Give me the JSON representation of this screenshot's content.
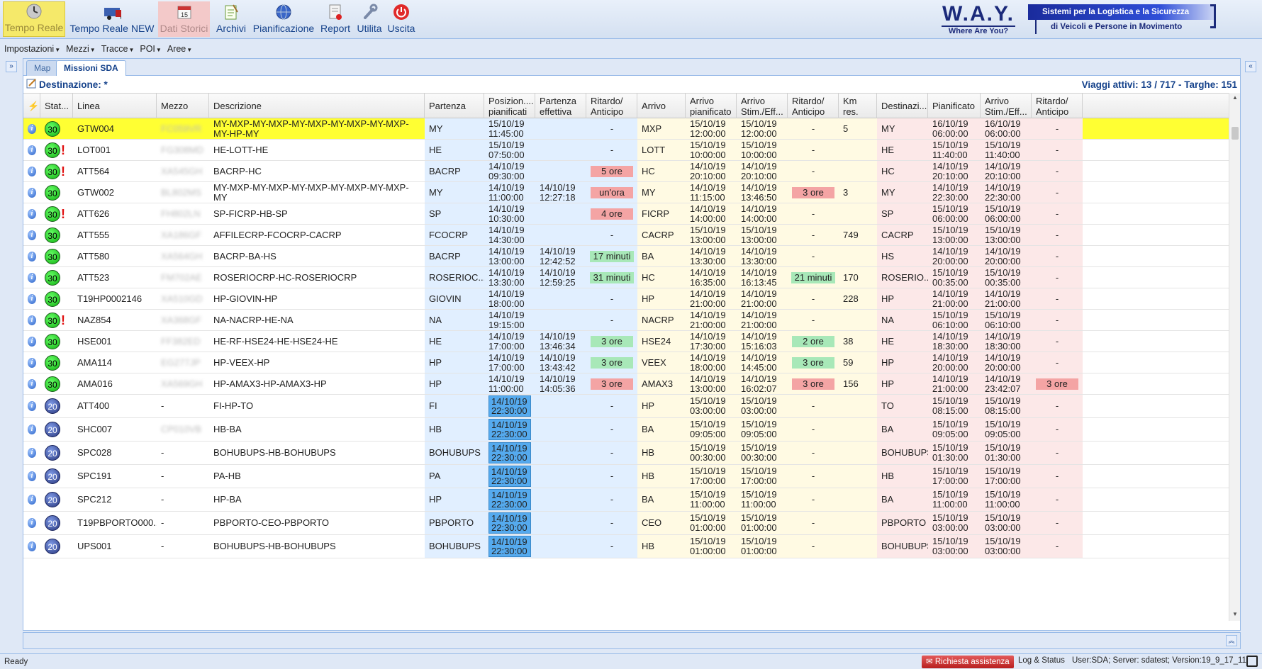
{
  "toolbar": {
    "buttons": [
      {
        "label": "Tempo Reale",
        "icon": "clock-icon",
        "state": "active"
      },
      {
        "label": "Tempo Reale NEW",
        "icon": "trucks-icon",
        "state": "normal"
      },
      {
        "label": "Dati Storici",
        "icon": "calendar-icon",
        "state": "disabled",
        "calendar_day": "15"
      },
      {
        "label": "Archivi",
        "icon": "notepad-icon",
        "state": "normal"
      },
      {
        "label": "Pianificazione",
        "icon": "globe-icon",
        "state": "normal"
      },
      {
        "label": "Report",
        "icon": "report-icon",
        "state": "normal"
      },
      {
        "label": "Utilita",
        "icon": "wrench-icon",
        "state": "normal"
      },
      {
        "label": "Uscita",
        "icon": "power-icon",
        "state": "normal"
      }
    ],
    "logo_title": "W.A.Y.",
    "logo_subtitle": "Where Are You?",
    "brand_line1": "Sistemi per la Logistica e la Sicurezza",
    "brand_line2": "di Veicoli e Persone in Movimento"
  },
  "menu": [
    "Impostazioni",
    "Mezzi",
    "Tracce",
    "POI",
    "Aree"
  ],
  "tabs": [
    {
      "label": "Map"
    },
    {
      "label": "Missioni SDA"
    }
  ],
  "panel": {
    "title": "Destinazione: *",
    "summary": "Viaggi attivi: 13 / 717 - Targhe: 151"
  },
  "columns": [
    "",
    "Stat...",
    "Linea",
    "Mezzo",
    "Descrizione",
    "Partenza",
    "Posizion.... pianificati",
    "Partenza effettiva",
    "Ritardo/ Anticipo",
    "Arrivo",
    "Arrivo pianificato",
    "Arrivo Stim./Eff...",
    "Ritardo/ Anticipo",
    "Km res.",
    "Destinazi...",
    "Pianificato",
    "Arrivo Stim./Eff...",
    "Ritardo/ Anticipo"
  ],
  "rows": [
    {
      "status": "30",
      "alert": false,
      "linea": "GTW004",
      "mezzo": "FC059VR",
      "mezzo_blur": true,
      "desc": "MY-MXP-MY-MXP-MY-MXP-MY-MXP-MY-MXP-MY-HP-MY",
      "dep": "MY",
      "dep_plan": "15/10/19 11:45:00",
      "dep_eff": "",
      "dep_delay": "-",
      "dep_delay_kind": "",
      "arr": "MXP",
      "arr_plan": "15/10/19 12:00:00",
      "arr_est": "15/10/19 12:00:00",
      "arr_delay": "-",
      "arr_delay_kind": "",
      "km": "5",
      "dst": "MY",
      "dst_plan": "16/10/19 06:00:00",
      "dst_est": "16/10/19 06:00:00",
      "dst_delay": "-",
      "dst_delay_kind": ""
    },
    {
      "status": "30",
      "alert": true,
      "linea": "LOT001",
      "mezzo": "FG308MD",
      "mezzo_blur": true,
      "desc": "HE-LOTT-HE",
      "dep": "HE",
      "dep_plan": "15/10/19 07:50:00",
      "dep_eff": "",
      "dep_delay": "-",
      "dep_delay_kind": "",
      "arr": "LOTT",
      "arr_plan": "15/10/19 10:00:00",
      "arr_est": "15/10/19 10:00:00",
      "arr_delay": "-",
      "arr_delay_kind": "",
      "km": "",
      "dst": "HE",
      "dst_plan": "15/10/19 11:40:00",
      "dst_est": "15/10/19 11:40:00",
      "dst_delay": "-",
      "dst_delay_kind": ""
    },
    {
      "status": "30",
      "alert": true,
      "linea": "ATT564",
      "mezzo": "XA545GH",
      "mezzo_blur": true,
      "desc": "BACRP-HC",
      "dep": "BACRP",
      "dep_plan": "14/10/19 09:30:00",
      "dep_eff": "",
      "dep_delay": "5 ore",
      "dep_delay_kind": "late",
      "arr": "HC",
      "arr_plan": "14/10/19 20:10:00",
      "arr_est": "14/10/19 20:10:00",
      "arr_delay": "-",
      "arr_delay_kind": "",
      "km": "",
      "dst": "HC",
      "dst_plan": "14/10/19 20:10:00",
      "dst_est": "14/10/19 20:10:00",
      "dst_delay": "-",
      "dst_delay_kind": ""
    },
    {
      "status": "30",
      "alert": false,
      "linea": "GTW002",
      "mezzo": "BL802MS",
      "mezzo_blur": true,
      "desc": "MY-MXP-MY-MXP-MY-MXP-MY-MXP-MY-MXP-MY",
      "dep": "MY",
      "dep_plan": "14/10/19 11:00:00",
      "dep_eff": "14/10/19 12:27:18",
      "dep_delay": "un'ora",
      "dep_delay_kind": "late",
      "arr": "MY",
      "arr_plan": "14/10/19 11:15:00",
      "arr_est": "14/10/19 13:46:50",
      "arr_delay": "3 ore",
      "arr_delay_kind": "late",
      "km": "3",
      "dst": "MY",
      "dst_plan": "14/10/19 22:30:00",
      "dst_est": "14/10/19 22:30:00",
      "dst_delay": "-",
      "dst_delay_kind": ""
    },
    {
      "status": "30",
      "alert": true,
      "linea": "ATT626",
      "mezzo": "FH802LN",
      "mezzo_blur": true,
      "desc": "SP-FICRP-HB-SP",
      "dep": "SP",
      "dep_plan": "14/10/19 10:30:00",
      "dep_eff": "",
      "dep_delay": "4 ore",
      "dep_delay_kind": "late",
      "arr": "FICRP",
      "arr_plan": "14/10/19 14:00:00",
      "arr_est": "14/10/19 14:00:00",
      "arr_delay": "-",
      "arr_delay_kind": "",
      "km": "",
      "dst": "SP",
      "dst_plan": "15/10/19 06:00:00",
      "dst_est": "15/10/19 06:00:00",
      "dst_delay": "-",
      "dst_delay_kind": ""
    },
    {
      "status": "30",
      "alert": false,
      "linea": "ATT555",
      "mezzo": "XA186GF",
      "mezzo_blur": true,
      "desc": "AFFILECRP-FCOCRP-CACRP",
      "dep": "FCOCRP",
      "dep_plan": "14/10/19 14:30:00",
      "dep_eff": "",
      "dep_delay": "-",
      "dep_delay_kind": "",
      "arr": "CACRP",
      "arr_plan": "15/10/19 13:00:00",
      "arr_est": "15/10/19 13:00:00",
      "arr_delay": "-",
      "arr_delay_kind": "",
      "km": "749",
      "dst": "CACRP",
      "dst_plan": "15/10/19 13:00:00",
      "dst_est": "15/10/19 13:00:00",
      "dst_delay": "-",
      "dst_delay_kind": ""
    },
    {
      "status": "30",
      "alert": false,
      "linea": "ATT580",
      "mezzo": "XA564GH",
      "mezzo_blur": true,
      "desc": "BACRP-BA-HS",
      "dep": "BACRP",
      "dep_plan": "14/10/19 13:00:00",
      "dep_eff": "14/10/19 12:42:52",
      "dep_delay": "17 minuti",
      "dep_delay_kind": "early",
      "arr": "BA",
      "arr_plan": "14/10/19 13:30:00",
      "arr_est": "14/10/19 13:30:00",
      "arr_delay": "-",
      "arr_delay_kind": "",
      "km": "",
      "dst": "HS",
      "dst_plan": "14/10/19 20:00:00",
      "dst_est": "14/10/19 20:00:00",
      "dst_delay": "-",
      "dst_delay_kind": ""
    },
    {
      "status": "30",
      "alert": false,
      "linea": "ATT523",
      "mezzo": "FM702AE",
      "mezzo_blur": true,
      "desc": "ROSERIOCRP-HC-ROSERIOCRP",
      "dep": "ROSERIOC...",
      "dep_plan": "14/10/19 13:30:00",
      "dep_eff": "14/10/19 12:59:25",
      "dep_delay": "31 minuti",
      "dep_delay_kind": "early",
      "arr": "HC",
      "arr_plan": "14/10/19 16:35:00",
      "arr_est": "14/10/19 16:13:45",
      "arr_delay": "21 minuti",
      "arr_delay_kind": "early",
      "km": "170",
      "dst": "ROSERIO...",
      "dst_plan": "15/10/19 00:35:00",
      "dst_est": "15/10/19 00:35:00",
      "dst_delay": "-",
      "dst_delay_kind": ""
    },
    {
      "status": "30",
      "alert": false,
      "linea": "T19HP0002146",
      "mezzo": "XA510GD",
      "mezzo_blur": true,
      "desc": "HP-GIOVIN-HP",
      "dep": "GIOVIN",
      "dep_plan": "14/10/19 18:00:00",
      "dep_eff": "",
      "dep_delay": "-",
      "dep_delay_kind": "",
      "arr": "HP",
      "arr_plan": "14/10/19 21:00:00",
      "arr_est": "14/10/19 21:00:00",
      "arr_delay": "-",
      "arr_delay_kind": "",
      "km": "228",
      "dst": "HP",
      "dst_plan": "14/10/19 21:00:00",
      "dst_est": "14/10/19 21:00:00",
      "dst_delay": "-",
      "dst_delay_kind": ""
    },
    {
      "status": "30",
      "alert": true,
      "linea": "NAZ854",
      "mezzo": "XA368GF",
      "mezzo_blur": true,
      "desc": "NA-NACRP-HE-NA",
      "dep": "NA",
      "dep_plan": "14/10/19 19:15:00",
      "dep_eff": "",
      "dep_delay": "-",
      "dep_delay_kind": "",
      "arr": "NACRP",
      "arr_plan": "14/10/19 21:00:00",
      "arr_est": "14/10/19 21:00:00",
      "arr_delay": "-",
      "arr_delay_kind": "",
      "km": "",
      "dst": "NA",
      "dst_plan": "15/10/19 06:10:00",
      "dst_est": "15/10/19 06:10:00",
      "dst_delay": "-",
      "dst_delay_kind": ""
    },
    {
      "status": "30",
      "alert": false,
      "linea": "HSE001",
      "mezzo": "FF382ED",
      "mezzo_blur": true,
      "desc": "HE-RF-HSE24-HE-HSE24-HE",
      "dep": "HE",
      "dep_plan": "14/10/19 17:00:00",
      "dep_eff": "14/10/19 13:46:34",
      "dep_delay": "3 ore",
      "dep_delay_kind": "early",
      "arr": "HSE24",
      "arr_plan": "14/10/19 17:30:00",
      "arr_est": "14/10/19 15:16:03",
      "arr_delay": "2 ore",
      "arr_delay_kind": "early",
      "km": "38",
      "dst": "HE",
      "dst_plan": "14/10/19 18:30:00",
      "dst_est": "14/10/19 18:30:00",
      "dst_delay": "-",
      "dst_delay_kind": ""
    },
    {
      "status": "30",
      "alert": false,
      "linea": "AMA114",
      "mezzo": "EG277JP",
      "mezzo_blur": true,
      "desc": "HP-VEEX-HP",
      "dep": "HP",
      "dep_plan": "14/10/19 17:00:00",
      "dep_eff": "14/10/19 13:43:42",
      "dep_delay": "3 ore",
      "dep_delay_kind": "early",
      "arr": "VEEX",
      "arr_plan": "14/10/19 18:00:00",
      "arr_est": "14/10/19 14:45:00",
      "arr_delay": "3 ore",
      "arr_delay_kind": "early",
      "km": "59",
      "dst": "HP",
      "dst_plan": "14/10/19 20:00:00",
      "dst_est": "14/10/19 20:00:00",
      "dst_delay": "-",
      "dst_delay_kind": ""
    },
    {
      "status": "30",
      "alert": false,
      "linea": "AMA016",
      "mezzo": "XA569GH",
      "mezzo_blur": true,
      "desc": "HP-AMAX3-HP-AMAX3-HP",
      "dep": "HP",
      "dep_plan": "14/10/19 11:00:00",
      "dep_eff": "14/10/19 14:05:36",
      "dep_delay": "3 ore",
      "dep_delay_kind": "late",
      "arr": "AMAX3",
      "arr_plan": "14/10/19 13:00:00",
      "arr_est": "14/10/19 16:02:07",
      "arr_delay": "3 ore",
      "arr_delay_kind": "late",
      "km": "156",
      "dst": "HP",
      "dst_plan": "14/10/19 21:00:00",
      "dst_est": "14/10/19 23:42:07",
      "dst_delay": "3 ore",
      "dst_delay_kind": "late"
    },
    {
      "status": "20",
      "alert": false,
      "linea": "ATT400",
      "mezzo": "-",
      "mezzo_blur": false,
      "desc": "FI-HP-TO",
      "dep": "FI",
      "dep_plan": "14/10/19 22:30:00",
      "dep_plan_hl": true,
      "dep_eff": "",
      "dep_delay": "-",
      "dep_delay_kind": "",
      "arr": "HP",
      "arr_plan": "15/10/19 03:00:00",
      "arr_est": "15/10/19 03:00:00",
      "arr_delay": "-",
      "arr_delay_kind": "",
      "km": "",
      "dst": "TO",
      "dst_plan": "15/10/19 08:15:00",
      "dst_est": "15/10/19 08:15:00",
      "dst_delay": "-",
      "dst_delay_kind": ""
    },
    {
      "status": "20",
      "alert": false,
      "linea": "SHC007",
      "mezzo": "CP010VB",
      "mezzo_blur": true,
      "desc": "HB-BA",
      "dep": "HB",
      "dep_plan": "14/10/19 22:30:00",
      "dep_plan_hl": true,
      "dep_eff": "",
      "dep_delay": "-",
      "dep_delay_kind": "",
      "arr": "BA",
      "arr_plan": "15/10/19 09:05:00",
      "arr_est": "15/10/19 09:05:00",
      "arr_delay": "-",
      "arr_delay_kind": "",
      "km": "",
      "dst": "BA",
      "dst_plan": "15/10/19 09:05:00",
      "dst_est": "15/10/19 09:05:00",
      "dst_delay": "-",
      "dst_delay_kind": ""
    },
    {
      "status": "20",
      "alert": false,
      "linea": "SPC028",
      "mezzo": "-",
      "mezzo_blur": false,
      "desc": "BOHUBUPS-HB-BOHUBUPS",
      "dep": "BOHUBUPS",
      "dep_plan": "14/10/19 22:30:00",
      "dep_plan_hl": true,
      "dep_eff": "",
      "dep_delay": "-",
      "dep_delay_kind": "",
      "arr": "HB",
      "arr_plan": "15/10/19 00:30:00",
      "arr_est": "15/10/19 00:30:00",
      "arr_delay": "-",
      "arr_delay_kind": "",
      "km": "",
      "dst": "BOHUBUPS",
      "dst_plan": "15/10/19 01:30:00",
      "dst_est": "15/10/19 01:30:00",
      "dst_delay": "-",
      "dst_delay_kind": ""
    },
    {
      "status": "20",
      "alert": false,
      "linea": "SPC191",
      "mezzo": "-",
      "mezzo_blur": false,
      "desc": "PA-HB",
      "dep": "PA",
      "dep_plan": "14/10/19 22:30:00",
      "dep_plan_hl": true,
      "dep_eff": "",
      "dep_delay": "-",
      "dep_delay_kind": "",
      "arr": "HB",
      "arr_plan": "15/10/19 17:00:00",
      "arr_est": "15/10/19 17:00:00",
      "arr_delay": "-",
      "arr_delay_kind": "",
      "km": "",
      "dst": "HB",
      "dst_plan": "15/10/19 17:00:00",
      "dst_est": "15/10/19 17:00:00",
      "dst_delay": "-",
      "dst_delay_kind": ""
    },
    {
      "status": "20",
      "alert": false,
      "linea": "SPC212",
      "mezzo": "-",
      "mezzo_blur": false,
      "desc": "HP-BA",
      "dep": "HP",
      "dep_plan": "14/10/19 22:30:00",
      "dep_plan_hl": true,
      "dep_eff": "",
      "dep_delay": "-",
      "dep_delay_kind": "",
      "arr": "BA",
      "arr_plan": "15/10/19 11:00:00",
      "arr_est": "15/10/19 11:00:00",
      "arr_delay": "-",
      "arr_delay_kind": "",
      "km": "",
      "dst": "BA",
      "dst_plan": "15/10/19 11:00:00",
      "dst_est": "15/10/19 11:00:00",
      "dst_delay": "-",
      "dst_delay_kind": ""
    },
    {
      "status": "20",
      "alert": false,
      "linea": "T19PBPORTO000...",
      "mezzo": "-",
      "mezzo_blur": false,
      "desc": "PBPORTO-CEO-PBPORTO",
      "dep": "PBPORTO",
      "dep_plan": "14/10/19 22:30:00",
      "dep_plan_hl": true,
      "dep_eff": "",
      "dep_delay": "-",
      "dep_delay_kind": "",
      "arr": "CEO",
      "arr_plan": "15/10/19 01:00:00",
      "arr_est": "15/10/19 01:00:00",
      "arr_delay": "-",
      "arr_delay_kind": "",
      "km": "",
      "dst": "PBPORTO",
      "dst_plan": "15/10/19 03:00:00",
      "dst_est": "15/10/19 03:00:00",
      "dst_delay": "-",
      "dst_delay_kind": ""
    },
    {
      "status": "20",
      "alert": false,
      "linea": "UPS001",
      "mezzo": "-",
      "mezzo_blur": false,
      "desc": "BOHUBUPS-HB-BOHUBUPS",
      "dep": "BOHUBUPS",
      "dep_plan": "14/10/19 22:30:00",
      "dep_plan_hl": true,
      "dep_eff": "",
      "dep_delay": "-",
      "dep_delay_kind": "",
      "arr": "HB",
      "arr_plan": "15/10/19 01:00:00",
      "arr_est": "15/10/19 01:00:00",
      "arr_delay": "-",
      "arr_delay_kind": "",
      "km": "",
      "dst": "BOHUBUPS",
      "dst_plan": "15/10/19 03:00:00",
      "dst_est": "15/10/19 03:00:00",
      "dst_delay": "-",
      "dst_delay_kind": ""
    }
  ],
  "statusbar": {
    "ready": "Ready",
    "help_button": "Richiesta assistenza",
    "log_status": "Log & Status",
    "server_info": "User:SDA; Server: sdatest; Version:19_9_17_11"
  },
  "colors": {
    "late": "#f4a4a4",
    "early": "#a8e8b8",
    "selected": "#ffff33",
    "departure_bg": "#e1efff",
    "arrival_bg": "#fffae3",
    "destination_bg": "#fce8e8"
  }
}
